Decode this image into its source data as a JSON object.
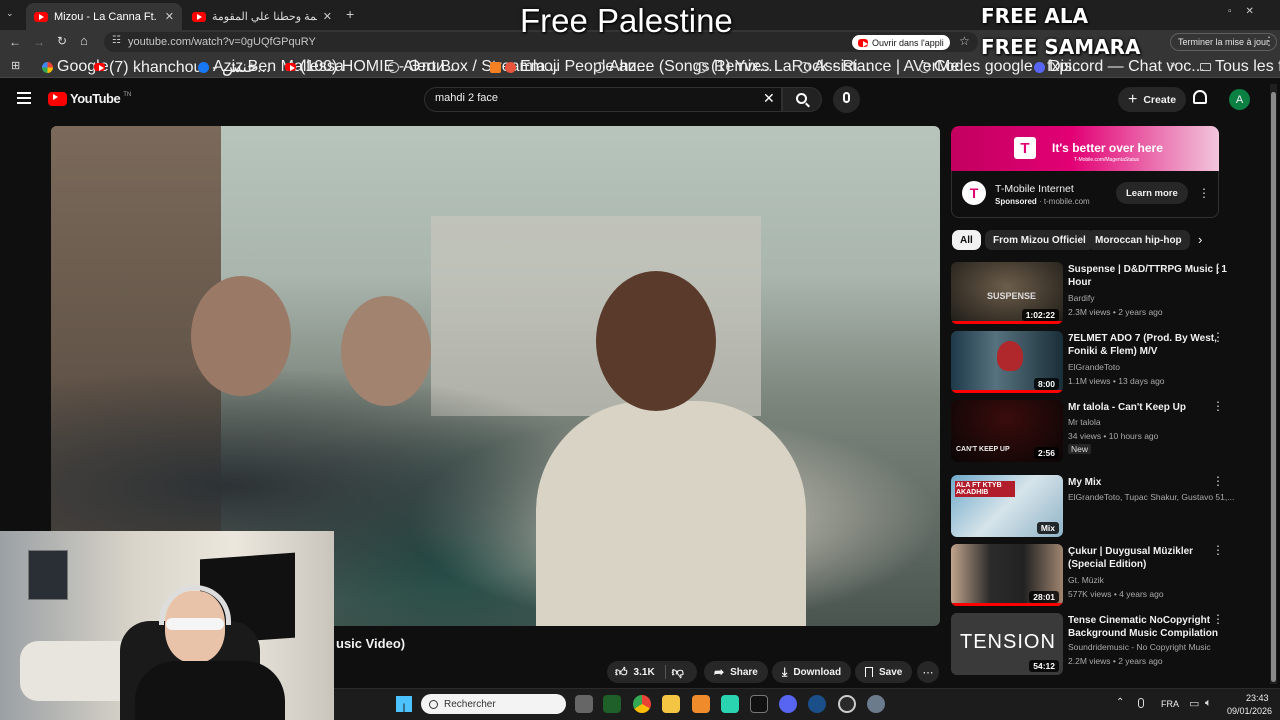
{
  "overlay": {
    "free_palestine": "Free Palestine",
    "free_ala": "FREE ALA",
    "free_samara": "FREE SAMARA"
  },
  "browser": {
    "tabs": [
      {
        "label": "Mizou - La Canna Ft. @KatibaS",
        "active": true
      },
      {
        "label": "كليب محكمة وحطنا علي المقومة",
        "active": false
      }
    ],
    "url": "youtube.com/watch?v=0gUQfGPquRY",
    "open_app": "Ouvrir dans l'appli",
    "update": "Terminer la mise à jour",
    "bookmarks": [
      "Google",
      "(7) khanchour - خنش...",
      "Aziz Ben Mallessa",
      "(100) HOMIE - Этои...",
      "Alert Box / Streamla...",
      "Emoji People an...",
      "Ahzee (Songs Remix...",
      "(1) Yves LaRock - Ri...",
      "Assistance | AVerMe...",
      "Codes google - fxpi...",
      "Discord — Chat voc..."
    ],
    "all_bookmarks": "Tous les favoris"
  },
  "youtube": {
    "logo": "YouTube",
    "region": "TN",
    "search_value": "mahdi 2 face",
    "create": "Create",
    "avatar": "A",
    "title_partial": "usic Video)",
    "actions": {
      "likes": "3.1K",
      "share": "Share",
      "download": "Download",
      "save": "Save"
    },
    "ad": {
      "banner": "It's better over here",
      "banner_sub": "T-Mobile.com/MagentaStatus",
      "brand": "T-Mobile Internet",
      "sponsored": "Sponsored",
      "domain": "t-mobile.com",
      "cta": "Learn more",
      "logo": "T"
    },
    "chips": [
      "All",
      "From Mizou Officiel",
      "Moroccan hip-hop"
    ],
    "recs": [
      {
        "title": "Suspense | D&D/TTRPG Music | 1 Hour",
        "channel": "Bardify",
        "meta": "2.3M views • 2 years ago",
        "duration": "1:02:22",
        "thumb_text": "SUSPENSE",
        "badge": ""
      },
      {
        "title": "7ELMET ADO 7 (Prod. By West, Foniki & Flem) M/V",
        "channel": "ElGrandeToto",
        "meta": "1.1M views • 13 days ago",
        "duration": "8:00",
        "thumb_text": "",
        "badge": ""
      },
      {
        "title": "Mr talola - Can't Keep Up",
        "channel": "Mr talola",
        "meta": "34 views • 10 hours ago",
        "duration": "2:56",
        "thumb_text": "CAN'T KEEP UP",
        "badge": "New"
      },
      {
        "title": "My Mix",
        "channel": "ElGrandeToto, Tupac Shakur, Gustavo 51,...",
        "meta": "",
        "duration": "Mix",
        "thumb_text": "ALA FT KTYB AKADHIB",
        "badge": ""
      },
      {
        "title": "Çukur | Duygusal Müzikler (Special Edition)",
        "channel": "Gt. Müzik",
        "meta": "577K views • 4 years ago",
        "duration": "28:01",
        "thumb_text": "",
        "badge": ""
      },
      {
        "title": "Tense Cinematic NoCopyright Background Music Compilation",
        "channel": "Soundridemusic - No Copyright Music",
        "meta": "2.2M views • 2 years ago",
        "duration": "54:12",
        "thumb_text": "TENSION",
        "badge": ""
      }
    ]
  },
  "taskbar": {
    "search": "Rechercher",
    "lang": "FRA",
    "time": "23:43",
    "date": "09/01/2026"
  }
}
